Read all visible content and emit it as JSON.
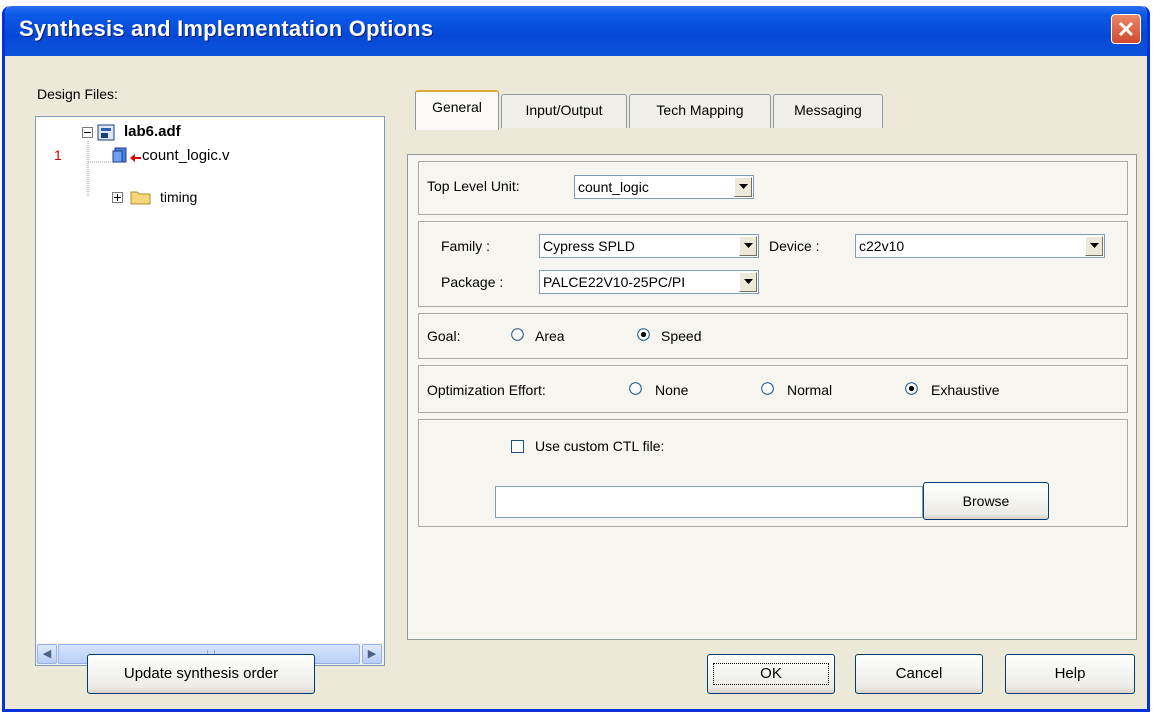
{
  "dialog": {
    "title": "Synthesis and Implementation Options"
  },
  "design_files": {
    "label": "Design Files:",
    "root": "lab6.adf",
    "row_number": "1",
    "file": "count_logic.v",
    "folder": "timing"
  },
  "tabs": [
    "General",
    "Input/Output",
    "Tech Mapping",
    "Messaging"
  ],
  "general": {
    "top_level_label": "Top Level Unit:",
    "top_level_value": "count_logic",
    "family_label": "Family :",
    "family_value": "Cypress SPLD",
    "device_label": "Device :",
    "device_value": "c22v10",
    "package_label": "Package :",
    "package_value": "PALCE22V10-25PC/PI",
    "goal_label": "Goal:",
    "goal_options": [
      "Area",
      "Speed"
    ],
    "goal_selected": "Speed",
    "effort_label": "Optimization Effort:",
    "effort_options": [
      "None",
      "Normal",
      "Exhaustive"
    ],
    "effort_selected": "Exhaustive",
    "custom_ctl_label": "Use custom CTL file:",
    "custom_ctl_checked": false,
    "ctl_path": "",
    "browse_label": "Browse"
  },
  "buttons": {
    "update_order": "Update synthesis order",
    "ok": "OK",
    "cancel": "Cancel",
    "help": "Help"
  },
  "colors": {
    "title_bar": "#0a5ae6",
    "close": "#d2492d",
    "dialog_bg": "#ece9d8",
    "tab_highlight": "#e3a638"
  }
}
